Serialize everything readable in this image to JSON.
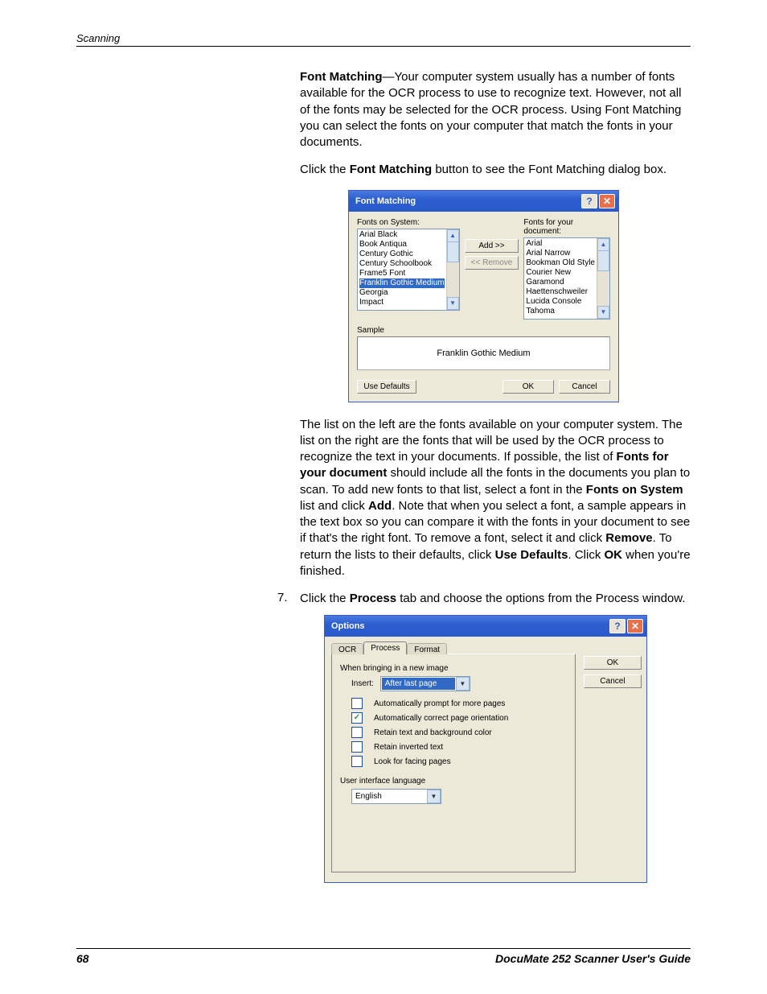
{
  "header": {
    "section": "Scanning"
  },
  "para1": {
    "lead_bold": "Font Matching",
    "rest": "—Your computer system usually has a number of fonts available for the OCR process to use to recognize text. However, not all of the fonts may be selected for the OCR process. Using Font Matching you can select the fonts on your computer that match the fonts in your documents."
  },
  "para2": {
    "pre": "Click the ",
    "bold": "Font Matching",
    "post": " button to see the Font Matching dialog box."
  },
  "fm": {
    "title": "Font Matching",
    "left_label": "Fonts on System:",
    "right_label": "Fonts for your document:",
    "system_fonts": [
      "Arial Black",
      "Book Antiqua",
      "Century Gothic",
      "Century Schoolbook",
      "Frame5 Font",
      "Franklin Gothic Medium",
      "Georgia",
      "Impact"
    ],
    "doc_fonts": [
      "Arial",
      "Arial Narrow",
      "Bookman Old Style",
      "Courier New",
      "Garamond",
      "Haettenschweiler",
      "Lucida Console",
      "Tahoma"
    ],
    "add_btn": "Add >>",
    "remove_btn": "<< Remove",
    "sample_label": "Sample",
    "sample_text": "Franklin Gothic Medium",
    "defaults_btn": "Use Defaults",
    "ok_btn": "OK",
    "cancel_btn": "Cancel"
  },
  "para3": {
    "t1": "The list on the left are the fonts available on your computer system. The list on the right are the fonts that will be used by the OCR process to recognize the text in your documents. If possible, the list of ",
    "b1": "Fonts for your document",
    "t2": " should include all the fonts in the documents you plan to scan. To add new fonts to that list, select a font in the ",
    "b2": "Fonts on System",
    "t3": " list and click ",
    "b3": "Add",
    "t4": ". Note that when you select a font, a sample appears in the text box so you can compare it with the fonts in your document to see if that's the right font. To remove a font, select it and click ",
    "b4": "Remove",
    "t5": ". To return the lists to their defaults, click ",
    "b5": "Use Defaults",
    "t6": ". Click ",
    "b6": "OK",
    "t7": " when you're finished."
  },
  "step7": {
    "num": "7.",
    "t1": "Click the ",
    "b1": "Process",
    "t2": " tab and choose the options from the Process window."
  },
  "opt": {
    "title": "Options",
    "tabs": {
      "ocr": "OCR",
      "process": "Process",
      "format": "Format"
    },
    "section1": "When bringing in a new image",
    "insert_label": "Insert:",
    "insert_value": "After last page",
    "checks": [
      {
        "label": "Automatically prompt for more pages",
        "checked": false
      },
      {
        "label": "Automatically correct page orientation",
        "checked": true
      },
      {
        "label": "Retain text and background color",
        "checked": false
      },
      {
        "label": "Retain inverted text",
        "checked": false
      },
      {
        "label": "Look for facing pages",
        "checked": false
      }
    ],
    "lang_label": "User interface language",
    "lang_value": "English",
    "ok_btn": "OK",
    "cancel_btn": "Cancel"
  },
  "footer": {
    "page": "68",
    "book": "DocuMate 252 Scanner User's Guide"
  }
}
